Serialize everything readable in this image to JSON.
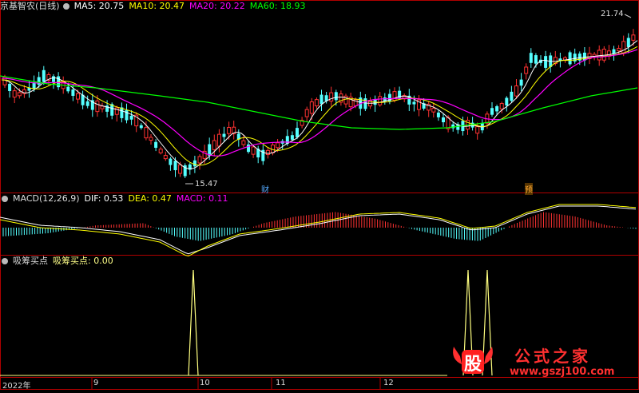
{
  "main_panel": {
    "title": "京基智农(日线)",
    "indicators": [
      {
        "label": "MA5: 20.75",
        "color": "#ffffff"
      },
      {
        "label": "MA10: 20.47",
        "color": "#ffff00"
      },
      {
        "label": "MA20: 20.22",
        "color": "#ff00ff"
      },
      {
        "label": "MA60: 18.93",
        "color": "#00ff00"
      }
    ],
    "high_label": "21.74",
    "low_label": "15.47",
    "marker_cai": "财",
    "marker_yu": "预"
  },
  "macd_panel": {
    "title": "MACD(12,26,9)",
    "dif": "DIF: 0.53",
    "dea": "DEA: 0.47",
    "macd": "MACD: 0.11"
  },
  "signal_panel": {
    "title": "吸筹买点",
    "value_label": "吸筹买点: 0.00"
  },
  "time_axis": [
    "2022年",
    "9",
    "10",
    "11",
    "12"
  ],
  "watermark": {
    "logo_char": "股",
    "site_name": "公式之家",
    "url": "www.gszj100.com"
  },
  "colors": {
    "up": "#ff3232",
    "down": "#54ffff",
    "ma5": "#ffffff",
    "ma10": "#ffff00",
    "ma20": "#ff00ff",
    "ma60": "#00ff00",
    "grid": "#b00000",
    "signal": "#ffff80"
  },
  "chart_data": {
    "type": "candlestick",
    "low_marked": 15.47,
    "high_marked": 21.74,
    "indicators": {
      "MA5": 20.75,
      "MA10": 20.47,
      "MA20": 20.22,
      "MA60": 18.93
    },
    "macd": {
      "DIF": 0.53,
      "DEA": 0.47,
      "MACD": 0.11
    },
    "signal_value": 0.0,
    "signal_peaks": 3
  }
}
